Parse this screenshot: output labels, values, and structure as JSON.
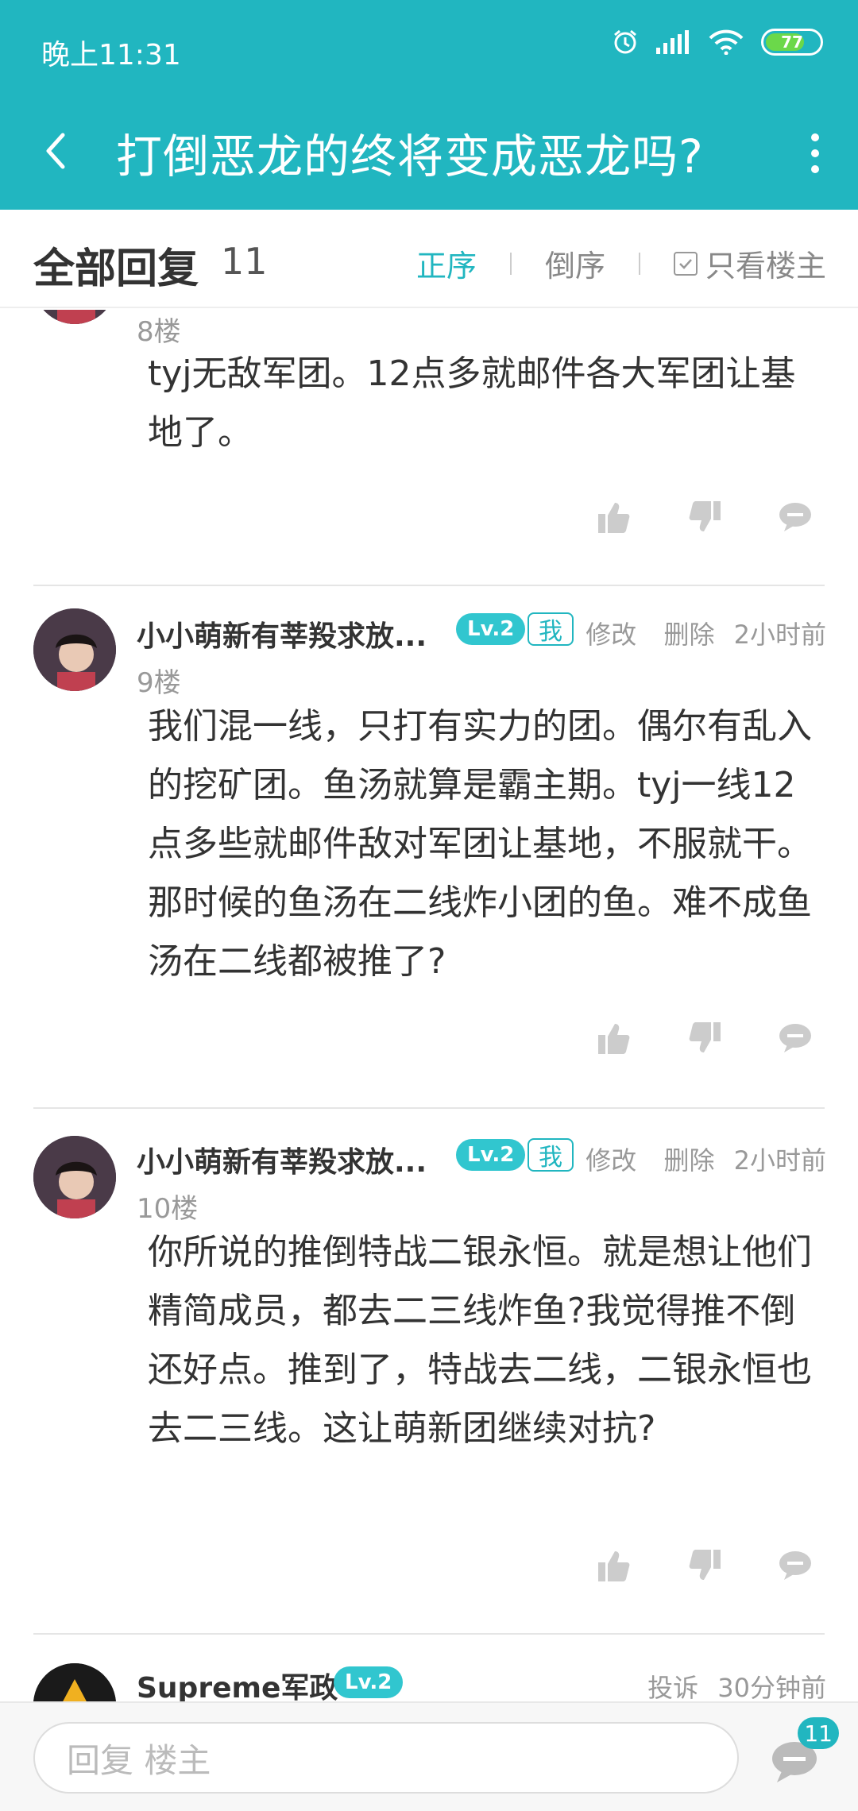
{
  "status_bar": {
    "time": "晚上11:31",
    "battery": "77"
  },
  "top_bar": {
    "title": "打倒恶龙的终将变成恶龙吗?"
  },
  "replies_header": {
    "label": "全部回复",
    "count": "11",
    "sort_asc": "正序",
    "sort_desc": "倒序",
    "only_op": "只看楼主"
  },
  "posts": [
    {
      "floor": "8楼",
      "content": "tyj无敌军团。12点多就邮件各大军团让基地了。"
    },
    {
      "name": "小小萌新有莘羖求放...",
      "level": "Lv.2",
      "me_tag": "我",
      "edit": "修改",
      "delete": "删除",
      "time": "2小时前",
      "floor": "9楼",
      "content": "我们混一线，只打有实力的团。偶尔有乱入的挖矿团。鱼汤就算是霸主期。tyj一线12点多些就邮件敌对军团让基地，不服就干。那时候的鱼汤在二线炸小团的鱼。难不成鱼汤在二线都被推了?"
    },
    {
      "name": "小小萌新有莘羖求放...",
      "level": "Lv.2",
      "me_tag": "我",
      "edit": "修改",
      "delete": "删除",
      "time": "2小时前",
      "floor": "10楼",
      "content": "你所说的推倒特战二银永恒。就是想让他们精简成员，都去二三线炸鱼?我觉得推不倒还好点。推到了，特战去二线，二银永恒也去二三线。这让萌新团继续对抗?"
    },
    {
      "name": "Supreme军政",
      "level": "Lv.2",
      "report": "投诉",
      "time": "30分钟前"
    }
  ],
  "bottom_bar": {
    "placeholder": "回复  楼主",
    "comment_count": "11"
  },
  "colors": {
    "accent": "#21b6c0"
  }
}
